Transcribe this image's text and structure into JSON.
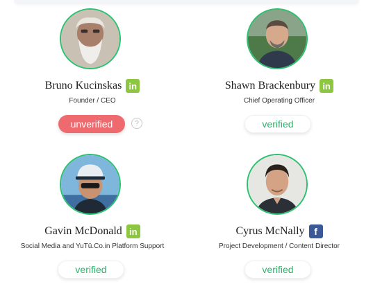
{
  "colors": {
    "avatar_ring": "#2cc170",
    "linkedin": "#8dc63f",
    "facebook": "#3b5998",
    "verified_text": "#2cb36b",
    "unverified_bg": "#ef6a6e"
  },
  "people": [
    {
      "name": "Bruno Kucinskas",
      "role": "Founder / CEO",
      "social": {
        "icon": "linkedin-icon",
        "glyph": "in"
      },
      "status": "unverified",
      "help_glyph": "?"
    },
    {
      "name": "Shawn Brackenbury",
      "role": "Chief Operating Officer",
      "social": {
        "icon": "linkedin-icon",
        "glyph": "in"
      },
      "status": "verified"
    },
    {
      "name": "Gavin McDonald",
      "role": "Social Media and YuTü.Co.in Platform Support",
      "social": {
        "icon": "linkedin-icon",
        "glyph": "in"
      },
      "status": "verified"
    },
    {
      "name": "Cyrus McNally",
      "role": "Project Development / Content Director",
      "social": {
        "icon": "facebook-icon",
        "glyph": "f"
      },
      "status": "verified"
    }
  ]
}
